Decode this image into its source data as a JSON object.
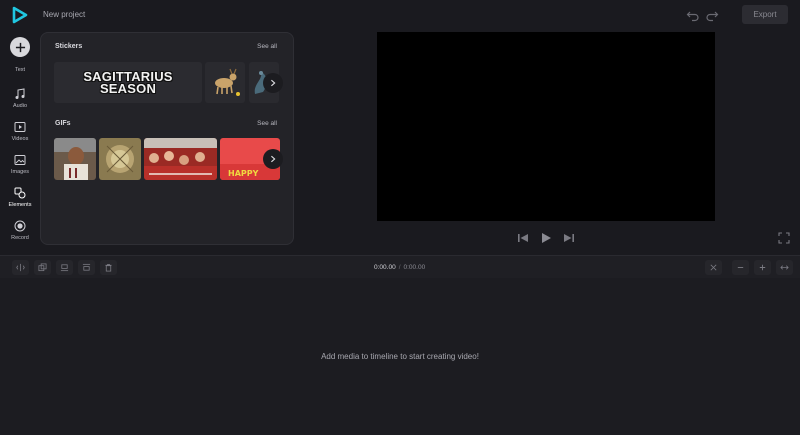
{
  "app": {
    "project_title": "New project",
    "export_label": "Export",
    "accent": "#20c7e0"
  },
  "nav": {
    "add_label": "Text",
    "items": [
      {
        "label": "Audio",
        "icon": "music-note-icon"
      },
      {
        "label": "Videos",
        "icon": "video-icon"
      },
      {
        "label": "Images",
        "icon": "image-icon"
      },
      {
        "label": "Elements",
        "icon": "shapes-icon"
      },
      {
        "label": "Record",
        "icon": "record-icon"
      }
    ]
  },
  "panel": {
    "stickers": {
      "title": "Stickers",
      "see_all": "See all",
      "items": [
        {
          "text_line1": "SAGITTARIUS",
          "text_line2": "SEASON"
        },
        {
          "text_line1": "",
          "text_line2": ""
        },
        {
          "text_line1": "",
          "text_line2": ""
        }
      ]
    },
    "gifs": {
      "title": "GIFs",
      "see_all": "See all",
      "items": [
        "gif-1",
        "gif-2",
        "gif-3",
        "gif-4"
      ],
      "gif4_caption": "HAPPY"
    }
  },
  "timeline": {
    "current_time": "0:00.00",
    "separator": "/",
    "duration": "0:00.00",
    "empty_message": "Add media to timeline to start creating video!"
  }
}
